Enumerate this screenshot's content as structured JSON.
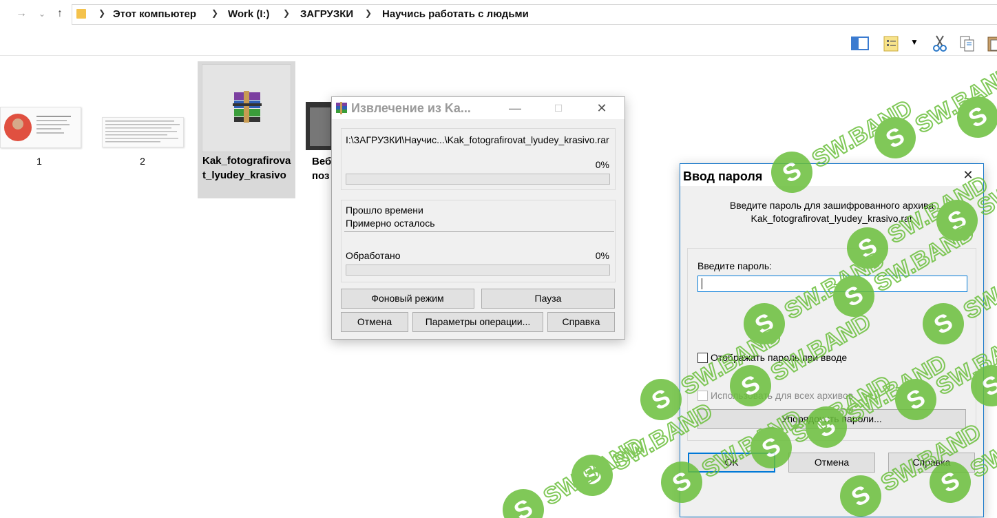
{
  "explorer": {
    "breadcrumbs": [
      "Этот компьютер",
      "Work (I:)",
      "ЗАГРУЗКИ",
      "Научись работать с людьми"
    ],
    "files": [
      {
        "label": "1"
      },
      {
        "label": "2"
      },
      {
        "label": "Kak_fotografirovat_lyudey_krasivo",
        "selected": true
      },
      {
        "label": "Веб поз"
      }
    ],
    "toolbar_icons": [
      "preview-pane-icon",
      "select-icon",
      "dropdown-icon",
      "cut-icon",
      "copy-icon",
      "paste-icon"
    ]
  },
  "extract_window": {
    "title": "Извлечение из Ka...",
    "archive_path": "I:\\ЗАГРУЗКИ\\Научис...\\Kak_fotografirovat_lyudey_krasivo.rar",
    "file_percent_text": "0%",
    "file_progress": 0,
    "elapsed_label": "Прошло времени",
    "remaining_label": "Примерно осталось",
    "processed_label": "Обработано",
    "processed_percent_text": "0%",
    "processed_progress": 0,
    "buttons": {
      "background": "Фоновый режим",
      "pause": "Пауза",
      "cancel": "Отмена",
      "options": "Параметры операции...",
      "help": "Справка"
    }
  },
  "password_window": {
    "title": "Ввод пароля",
    "prompt_line1": "Введите пароль для зашифрованного архива",
    "prompt_line2": "Kak_fotografirovat_lyudey_krasivo.rar",
    "password_label": "Введите пароль:",
    "password_value": "",
    "show_password_label": "Отображать пароль при вводе",
    "use_for_all_label": "Использовать для всех архивов",
    "organize_button": "Упорядочить пароли...",
    "ok_button": "OK",
    "cancel_button": "Отмена",
    "help_button": "Справка"
  },
  "watermark": {
    "text": "SW.BAND",
    "color": "#6abf3a"
  }
}
